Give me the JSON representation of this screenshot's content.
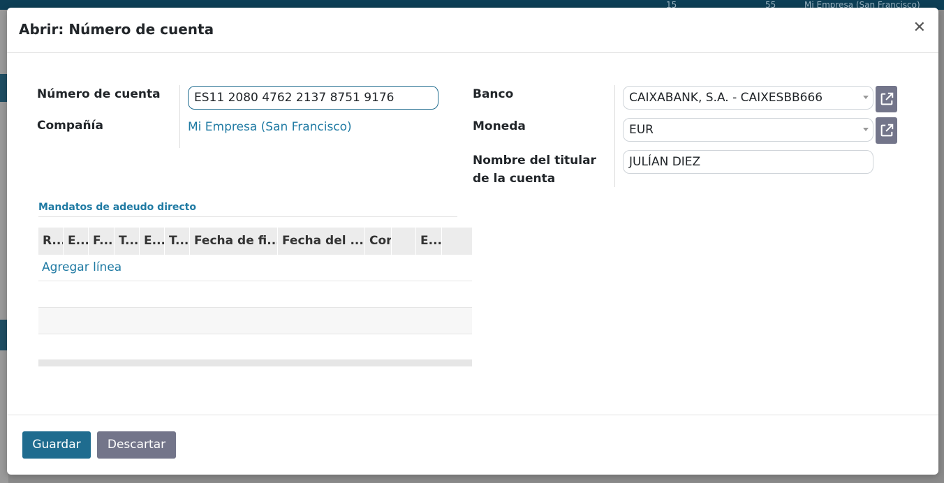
{
  "background": {
    "topbar_counts": [
      "15",
      "55"
    ],
    "topbar_company": "Mi Empresa (San Francisco)"
  },
  "dialog": {
    "title": "Abrir: Número de cuenta",
    "close_icon": "close-icon"
  },
  "form": {
    "account_number": {
      "label": "Número de cuenta",
      "value": "ES11 2080 4762 2137 8751 9176"
    },
    "company": {
      "label": "Compañía",
      "value": "Mi Empresa (San Francisco)"
    },
    "bank": {
      "label": "Banco",
      "value": "CAIXABANK, S.A. - CAIXESBB666"
    },
    "currency": {
      "label": "Moneda",
      "value": "EUR"
    },
    "holder": {
      "label_line1": "Nombre del titular",
      "label_line2": "de la cuenta",
      "value": "JULÍAN DIEZ"
    }
  },
  "mandates": {
    "title": "Mandatos de adeudo directo",
    "columns": [
      "R...",
      "E...",
      "F...",
      "T...",
      "E...",
      "T...",
      "Fecha de fi...",
      "Fecha del ...",
      "Cor",
      "",
      "E..."
    ],
    "add_line": "Agregar línea"
  },
  "footer": {
    "save": "Guardar",
    "discard": "Descartar"
  },
  "colors": {
    "primary": "#1f6c8f",
    "secondary": "#73758a",
    "link": "#1f7aa3"
  }
}
